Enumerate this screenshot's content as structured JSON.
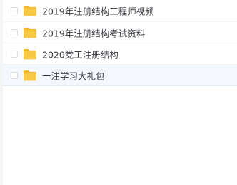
{
  "file_list": {
    "items": [
      {
        "name": "2019年注册结构工程师视频",
        "type": "folder",
        "selected": false
      },
      {
        "name": "2019年注册结构考试资料",
        "type": "folder",
        "selected": false
      },
      {
        "name": "2020党工注册结构",
        "type": "folder",
        "selected": false
      },
      {
        "name": "一注学习大礼包",
        "type": "folder",
        "selected": true
      }
    ]
  },
  "icons": {
    "folder": "folder-icon",
    "checkbox": "checkbox"
  },
  "colors": {
    "folder_body": "#f7c844",
    "folder_tab": "#f4b72c",
    "selected_row_bg": "#f3f8fe",
    "text": "#3b3f45"
  }
}
